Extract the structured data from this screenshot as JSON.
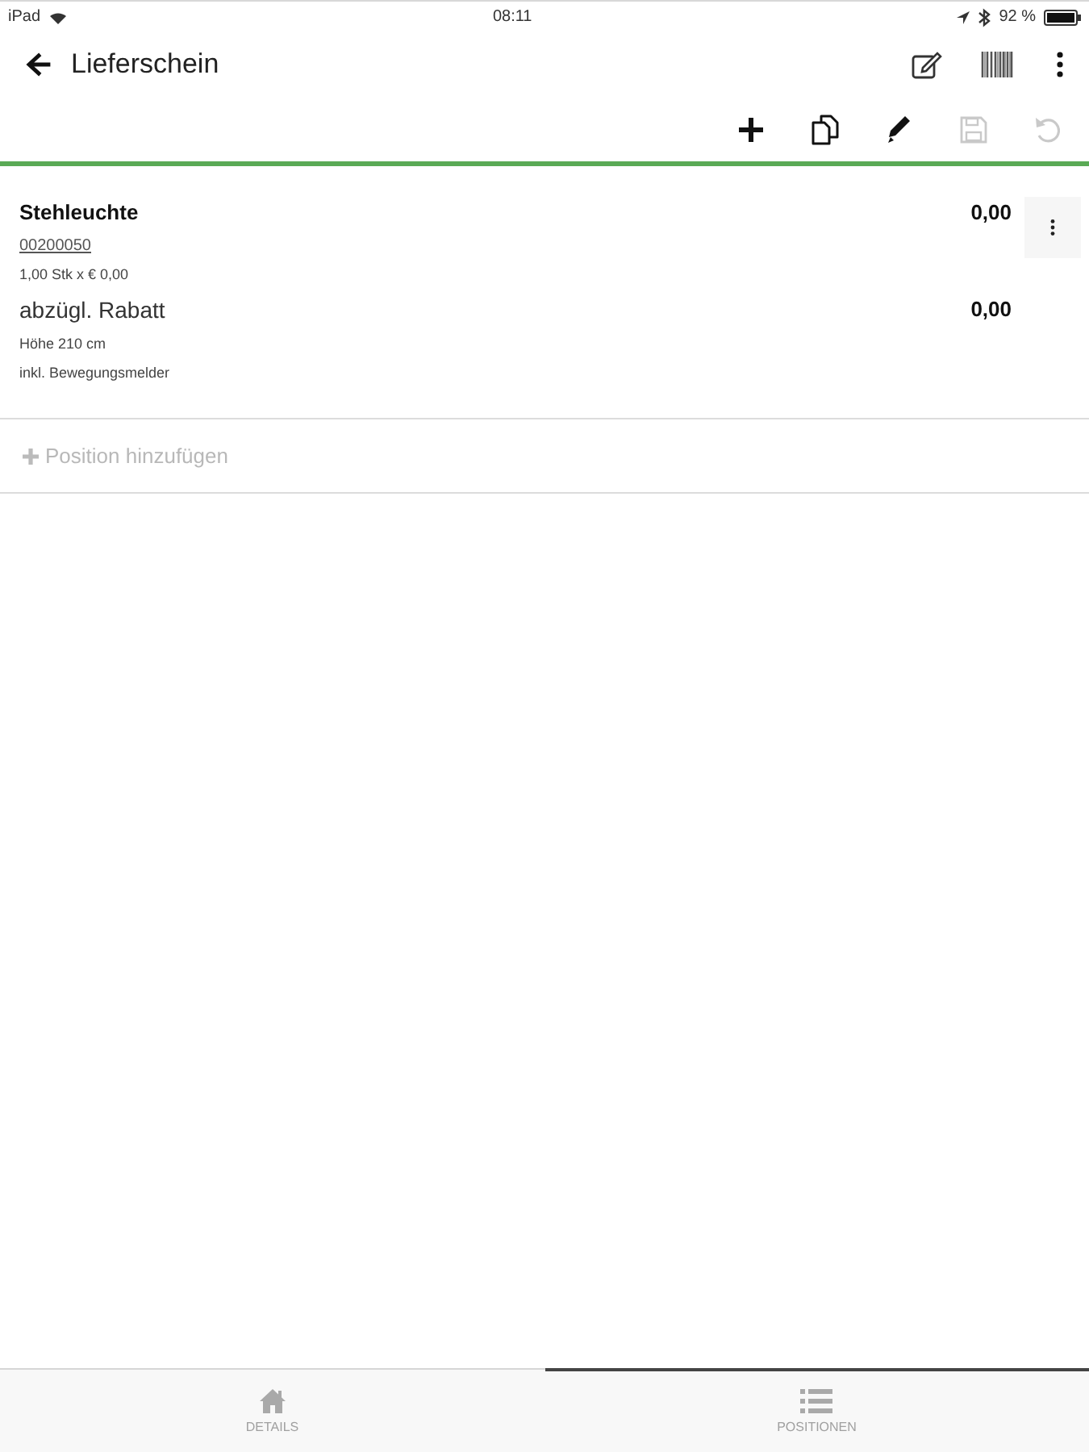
{
  "status_bar": {
    "device": "iPad",
    "time": "08:11",
    "battery": "92 %"
  },
  "header": {
    "title": "Lieferschein",
    "actions": [
      {
        "kind": "note-edit"
      },
      {
        "kind": "barcode"
      },
      {
        "kind": "more"
      }
    ]
  },
  "toolbar": {
    "actions": [
      {
        "kind": "add",
        "disabled": false
      },
      {
        "kind": "copy",
        "disabled": false
      },
      {
        "kind": "edit",
        "disabled": false
      },
      {
        "kind": "save",
        "disabled": true
      },
      {
        "kind": "undo",
        "disabled": true
      }
    ]
  },
  "positions": [
    {
      "title": "Stehleuchte",
      "article_number": "00200050",
      "quantity": "1,00 Stk x € 0,00",
      "amount": "0,00",
      "discount": {
        "label": "abzügl. Rabatt",
        "amount": "0,00"
      },
      "notes": [
        "Höhe 210 cm",
        "inkl. Bewegungsmelder"
      ]
    }
  ],
  "add_position": {
    "label": "Position hinzufügen"
  },
  "bottom_tabs": [
    {
      "kind": "home",
      "label": "DETAILS",
      "selected": false
    },
    {
      "kind": "list",
      "label": "POSITIONEN",
      "selected": true
    }
  ]
}
